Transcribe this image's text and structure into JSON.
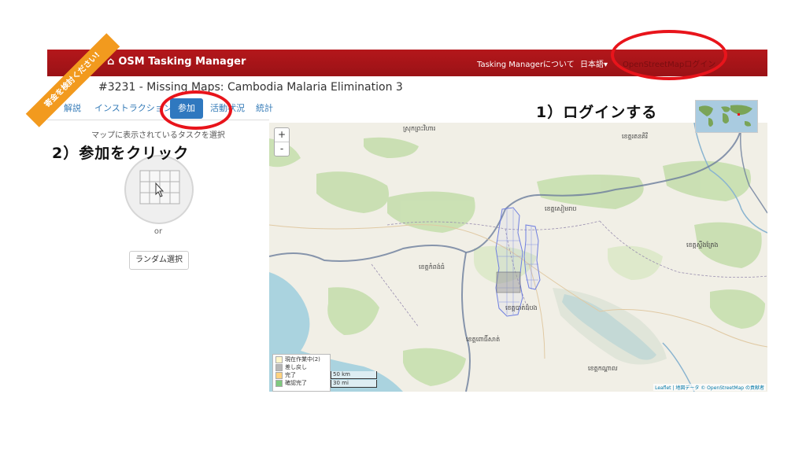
{
  "header": {
    "brand": "OSM Tasking Manager",
    "about": "Tasking Managerについて",
    "language": "日本語",
    "login": "OpenStreetMapログイン"
  },
  "ribbon": {
    "text": "寄金を検討ください!"
  },
  "project": {
    "title": "#3231 - Missing Maps: Cambodia Malaria Elimination 3"
  },
  "tabs": [
    {
      "label": "解説",
      "active": false
    },
    {
      "label": "インストラクション",
      "active": false
    },
    {
      "label": "参加",
      "active": true
    },
    {
      "label": "活動状況",
      "active": false
    },
    {
      "label": "統計",
      "active": false
    }
  ],
  "panel": {
    "heading": "マップに表示されているタスクを選択",
    "or": "or",
    "random_button": "ランダム選択"
  },
  "map": {
    "zoom_in": "+",
    "zoom_out": "-",
    "legend": [
      {
        "label": "現在作業中(2)",
        "color": "#fff6cc"
      },
      {
        "label": "差し戻し",
        "color": "#b7b7b7"
      },
      {
        "label": "完了",
        "color": "#ffd27f"
      },
      {
        "label": "確認完了",
        "color": "#7fc97f"
      }
    ],
    "scale": [
      "50 km",
      "30 mi"
    ],
    "attribution": "Leaflet | 地図データ © OpenStreetMap の貢献者",
    "places": [
      "ស្រុកព្រះវិហារ",
      "ខេត្តសៀមរាប",
      "ខេត្តកំពង់ធំ",
      "ខេត្តពោធិ៍សាត់",
      "ខេត្តបាត់ដំបង",
      "ខេត្តកណ្ដាល",
      "ខេត្តស្ទឹងត្រែង",
      "ខេត្តរតនគិរី"
    ]
  },
  "annotations": {
    "step1": "1）ログインする",
    "step2": "2）参加をクリック"
  },
  "colors": {
    "navbar": "#a8151a",
    "active_tab": "#2f78bf",
    "annotation_circle": "#e8141b",
    "ribbon": "#f29a1e",
    "task_outline": "#6f7fe0"
  }
}
